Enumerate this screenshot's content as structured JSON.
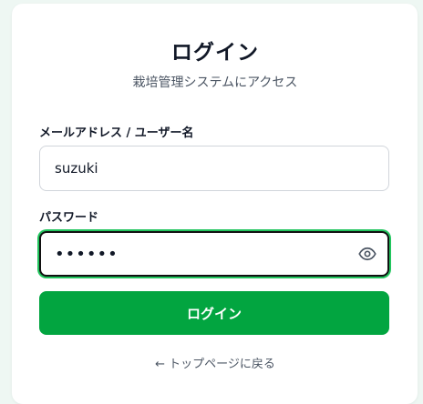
{
  "header": {
    "title": "ログイン",
    "subtitle": "栽培管理システムにアクセス"
  },
  "form": {
    "username_label": "メールアドレス / ユーザー名",
    "username_value": "suzuki",
    "password_label": "パスワード",
    "password_value": "••••••",
    "password_toggle_icon": "eye-icon",
    "submit_label": "ログイン"
  },
  "footer": {
    "back_link": "← トップページに戻る"
  },
  "colors": {
    "primary": "#02a540",
    "focus_ring": "#22c55e",
    "background": "#eef7f3"
  }
}
